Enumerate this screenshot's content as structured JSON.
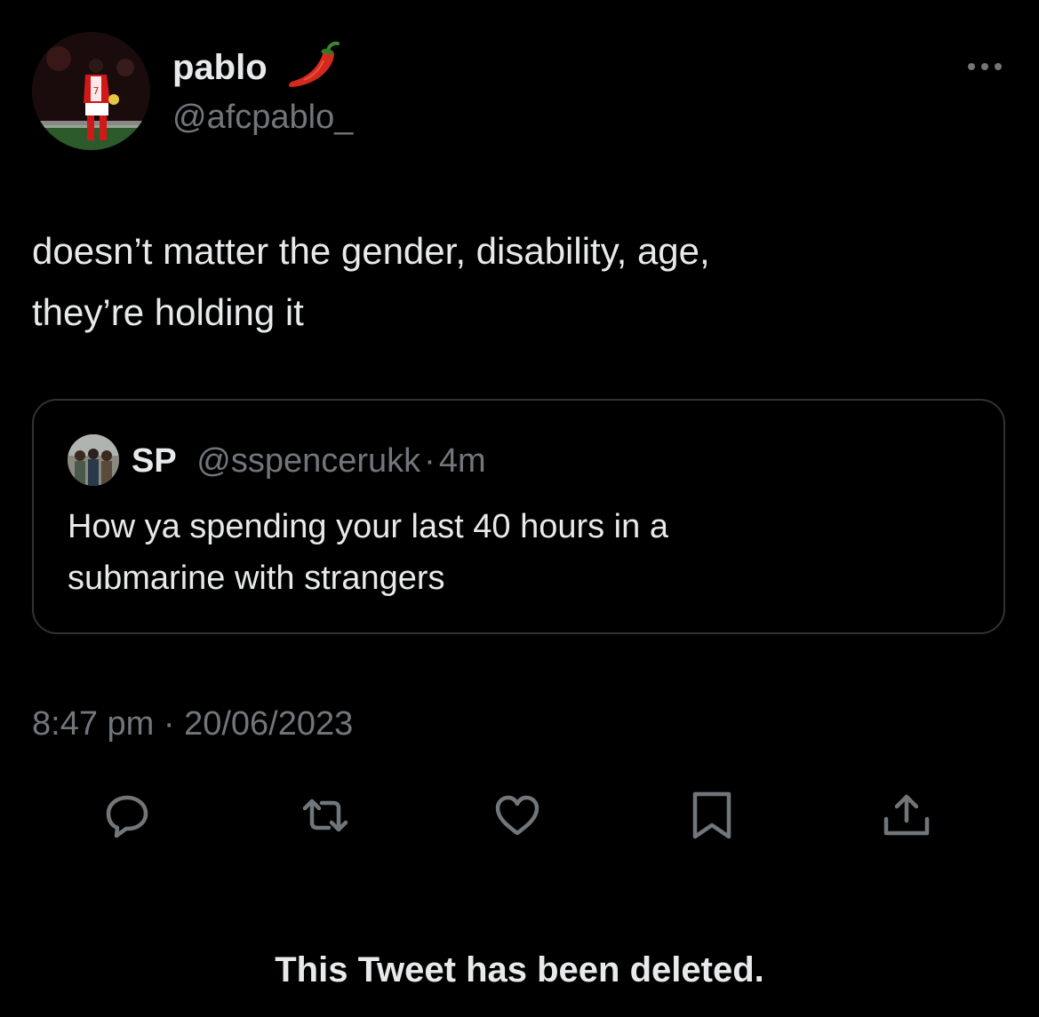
{
  "tweet": {
    "author": {
      "display_name": "pablo",
      "handle": "@afcpablo_",
      "name_emoji": "chili-pepper"
    },
    "text_lines": [
      "doesn’t matter the gender, disability, age,",
      "they’re holding it"
    ],
    "timestamp": "8:47 pm · 20/06/2023"
  },
  "quoted_tweet": {
    "author": {
      "display_name": "SP",
      "handle": "@sspencerukk",
      "time_ago": "4m",
      "separator": "·"
    },
    "text_lines": [
      "How ya spending your last 40 hours in a",
      "submarine with strangers"
    ]
  },
  "actions": [
    {
      "name": "reply",
      "icon": "reply-icon"
    },
    {
      "name": "retweet",
      "icon": "retweet-icon"
    },
    {
      "name": "like",
      "icon": "heart-icon"
    },
    {
      "name": "bookmark",
      "icon": "bookmark-icon"
    },
    {
      "name": "share",
      "icon": "share-icon"
    }
  ],
  "notice": "This Tweet has been deleted.",
  "colors": {
    "background": "#000000",
    "primary_text": "#e7e9ea",
    "secondary_text": "#71767b",
    "border": "#2f3336",
    "chili_red": "#d42a1e"
  }
}
